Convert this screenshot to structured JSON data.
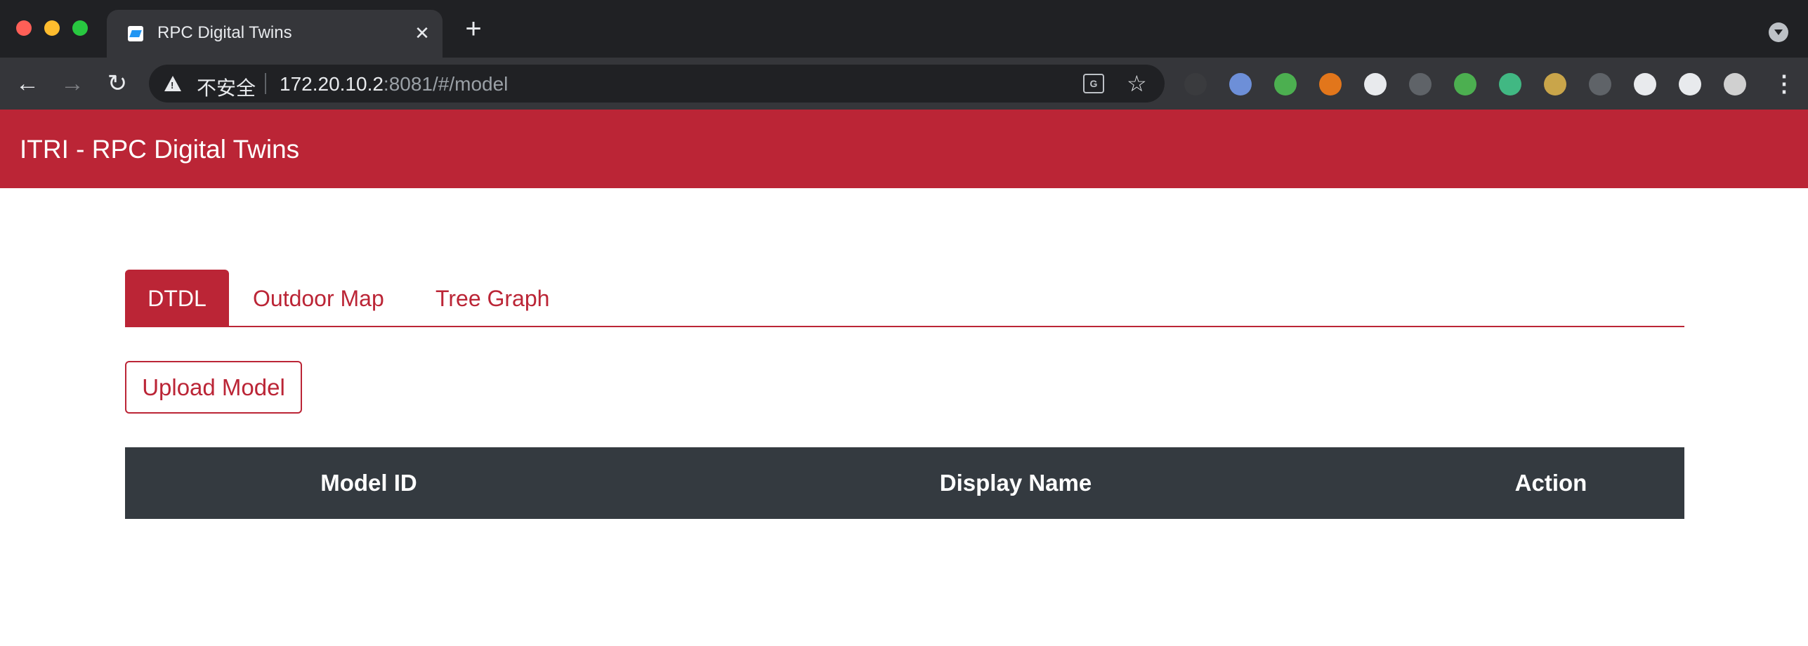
{
  "browser": {
    "tab_title": "RPC Digital Twins",
    "close_glyph": "✕",
    "new_tab_glyph": "+",
    "back_glyph": "←",
    "forward_glyph": "→",
    "reload_glyph": "↻",
    "security_label": "不安全",
    "url_host": "172.20.10.2",
    "url_rest": ":8081/#/model",
    "translate_glyph": "G",
    "star_glyph": "☆",
    "menu_glyph": "⋮",
    "extensions": [
      {
        "name": "extension-1-icon",
        "color": "#3a3b3e"
      },
      {
        "name": "extension-2-icon",
        "color": "#6d8fd8"
      },
      {
        "name": "extension-3-icon",
        "color": "#4caf50"
      },
      {
        "name": "metamask-icon",
        "color": "#e2761b"
      },
      {
        "name": "json-viewer-icon",
        "color": "#e8eaed"
      },
      {
        "name": "timer-icon",
        "color": "#5f6368"
      },
      {
        "name": "extension-7-icon",
        "color": "#4caf50"
      },
      {
        "name": "vue-devtools-icon",
        "color": "#41b883"
      },
      {
        "name": "image-icon",
        "color": "#c9a54a"
      },
      {
        "name": "move-icon",
        "color": "#5f6368"
      },
      {
        "name": "cursor-icon",
        "color": "#e8eaed"
      },
      {
        "name": "puzzle-icon",
        "color": "#e8eaed"
      },
      {
        "name": "profile-avatar-icon",
        "color": "#d0d0d0"
      }
    ]
  },
  "app": {
    "brand": "ITRI - RPC Digital Twins",
    "accent_color": "#bb2536"
  },
  "tabs": [
    {
      "label": "DTDL",
      "active": true
    },
    {
      "label": "Outdoor Map",
      "active": false
    },
    {
      "label": "Tree Graph",
      "active": false
    }
  ],
  "actions": {
    "upload_label": "Upload Model"
  },
  "table": {
    "columns": [
      "Model ID",
      "Display Name",
      "Action"
    ],
    "rows": []
  }
}
